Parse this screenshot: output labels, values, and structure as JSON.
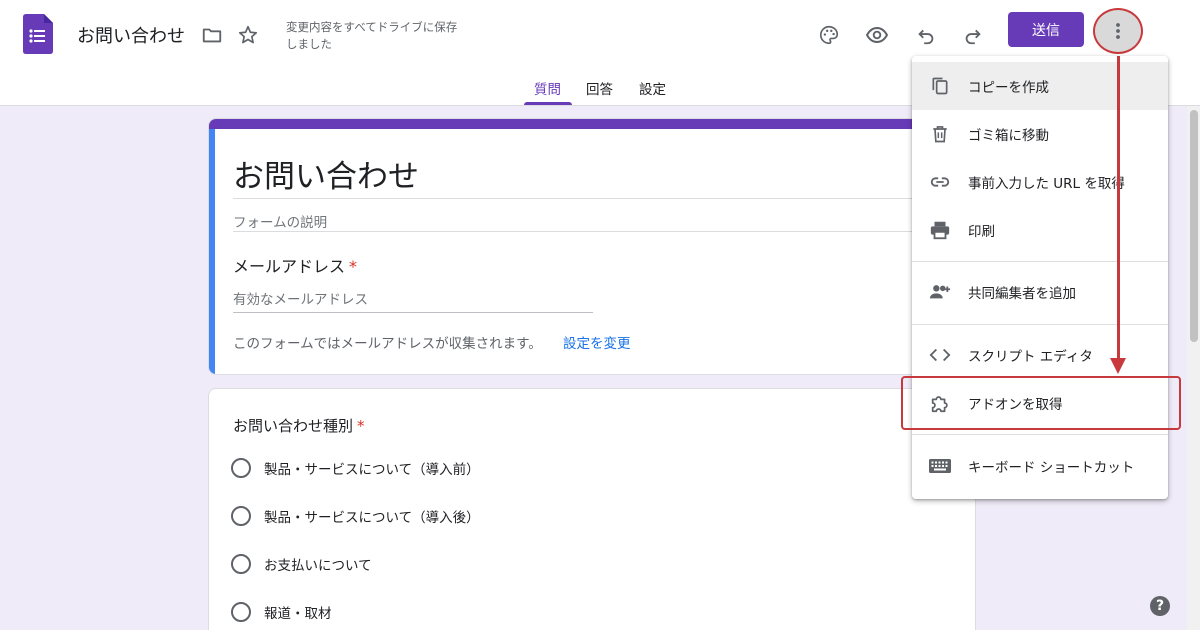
{
  "header": {
    "doc_title": "お問い合わせ",
    "save_status": "変更内容をすべてドライブに保存しました",
    "send_label": "送信",
    "icons": [
      "forms-logo",
      "folder-icon",
      "star-icon",
      "palette-icon",
      "eye-icon",
      "undo-icon",
      "redo-icon",
      "more-vert-icon"
    ]
  },
  "tabs": [
    {
      "label": "質問",
      "active": true
    },
    {
      "label": "回答",
      "active": false
    },
    {
      "label": "設定",
      "active": false
    }
  ],
  "form": {
    "title": "お問い合わせ",
    "description_placeholder": "フォームの説明",
    "email_question": "メールアドレス",
    "required_mark": "*",
    "email_placeholder": "有効なメールアドレス",
    "collect_note": "このフォームではメールアドレスが収集されます。",
    "collect_link": "設定を変更"
  },
  "question2": {
    "title": "お問い合わせ種別",
    "required_mark": "*",
    "options": [
      "製品・サービスについて（導入前）",
      "製品・サービスについて（導入後）",
      "お支払いについて",
      "報道・取材"
    ]
  },
  "menu": {
    "items": [
      {
        "label": "コピーを作成",
        "icon": "copy-icon"
      },
      {
        "label": "ゴミ箱に移動",
        "icon": "trash-icon"
      },
      {
        "label": "事前入力した URL を取得",
        "icon": "link-icon"
      },
      {
        "label": "印刷",
        "icon": "print-icon"
      },
      {
        "label": "共同編集者を追加",
        "icon": "add-people-icon"
      },
      {
        "label": "スクリプト エディタ",
        "icon": "code-icon"
      },
      {
        "label": "アドオンを取得",
        "icon": "puzzle-icon"
      },
      {
        "label": "キーボード ショートカット",
        "icon": "keyboard-icon"
      }
    ]
  },
  "colors": {
    "accent": "#673ab7",
    "annotation": "#c8393d",
    "link": "#1a73e8",
    "background": "#f0ebf8"
  },
  "help_label": "?"
}
